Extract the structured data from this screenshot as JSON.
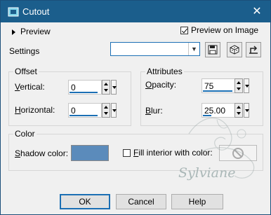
{
  "window": {
    "title": "Cutout"
  },
  "preview": {
    "toggle_label": "Preview",
    "preview_on_image_label": "Preview on Image",
    "preview_on_image_checked": true
  },
  "settings": {
    "label": "Settings",
    "select_value": ""
  },
  "offset": {
    "title": "Offset",
    "vertical_label": "Vertical:",
    "vertical_value": "0",
    "horizontal_label": "Horizontal:",
    "horizontal_value": "0"
  },
  "attributes": {
    "title": "Attributes",
    "opacity_label": "Opacity:",
    "opacity_value": "75",
    "blur_label": "Blur:",
    "blur_value": "25.00"
  },
  "color": {
    "title": "Color",
    "shadow_color_label": "Shadow color:",
    "shadow_color": "#5b8bbb",
    "fill_interior_label": "Fill interior with color:",
    "fill_interior_checked": false
  },
  "watermark": "Sylviane",
  "buttons": {
    "ok": "OK",
    "cancel": "Cancel",
    "help": "Help"
  },
  "colors": {
    "titlebar": "#1b5e8c",
    "accent": "#1b6fb4"
  }
}
